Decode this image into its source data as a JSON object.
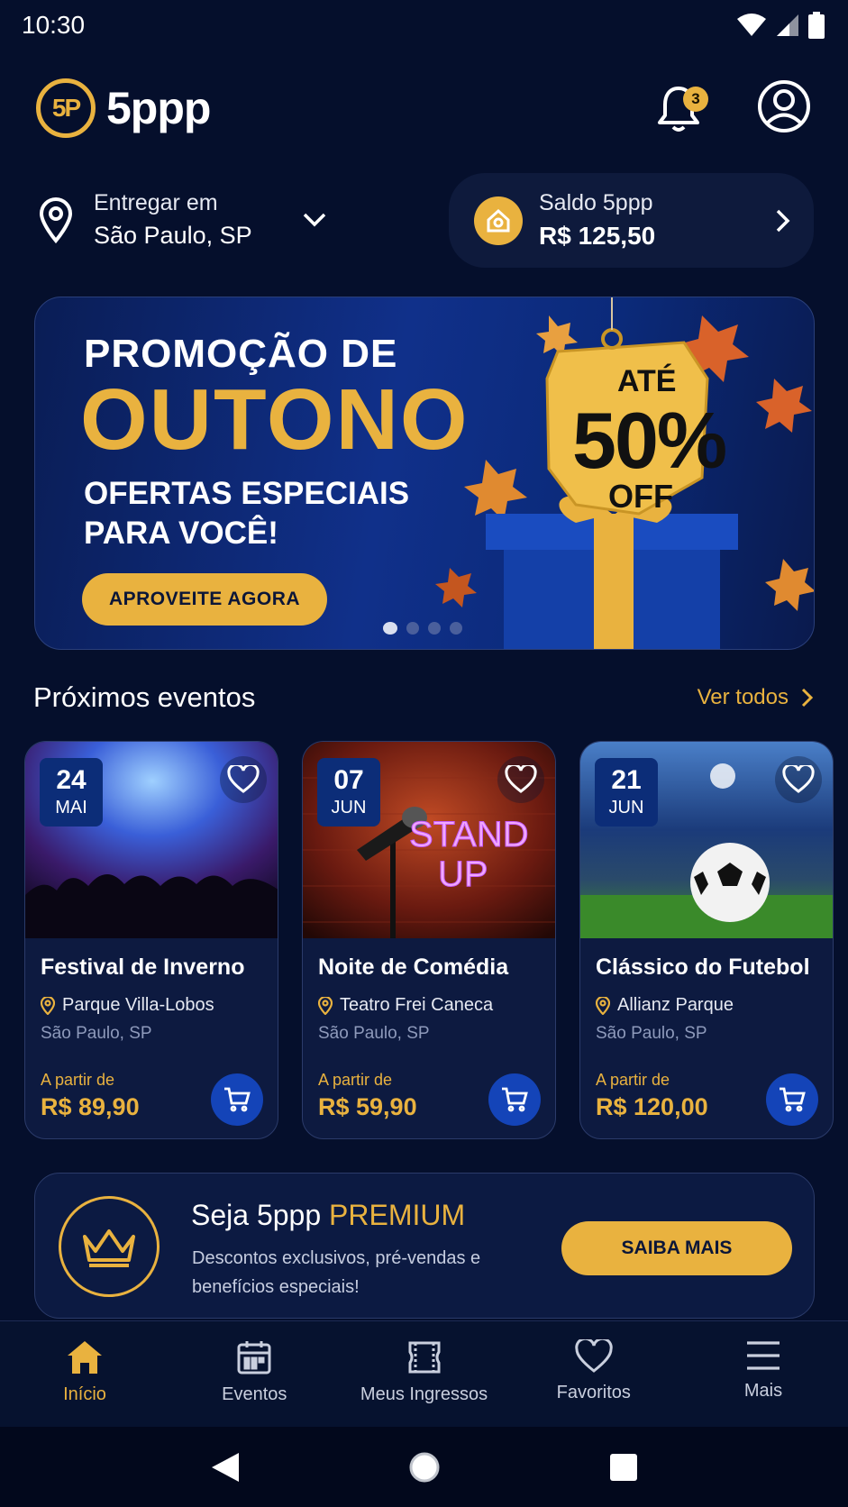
{
  "status_bar": {
    "time": "10:30"
  },
  "header": {
    "brand_name": "5ppp",
    "logo_text": "5P",
    "notifications_count": "3"
  },
  "location": {
    "label": "Entregar em",
    "value": "São Paulo, SP"
  },
  "balance": {
    "label": "Saldo 5ppp",
    "amount": "R$ 125,50"
  },
  "banner": {
    "line1": "PROMOÇÃO DE",
    "line2": "OUTONO",
    "line3": "OFERTAS ESPECIAIS PARA VOCÊ!",
    "cta": "APROVEITE AGORA",
    "tag_line1": "ATÉ",
    "tag_line2": "50%",
    "tag_line3": "OFF",
    "carousel_pages": 4,
    "carousel_active": 1
  },
  "events_section": {
    "title": "Próximos eventos",
    "see_all": "Ver todos"
  },
  "events": [
    {
      "day": "24",
      "month": "MAI",
      "name": "Festival de Inverno",
      "venue": "Parque Villa-Lobos",
      "city": "São Paulo, SP",
      "from_label": "A partir de",
      "price": "R$ 89,90",
      "image": "concert-crowd"
    },
    {
      "day": "07",
      "month": "JUN",
      "name": "Noite de Comédia",
      "venue": "Teatro Frei Caneca",
      "city": "São Paulo, SP",
      "from_label": "A partir de",
      "price": "R$ 59,90",
      "image": "stand-up-microphone",
      "image_text": "STAND UP"
    },
    {
      "day": "21",
      "month": "JUN",
      "name": "Clássico do Futebol",
      "venue": "Allianz Parque",
      "city": "São Paulo, SP",
      "from_label": "A partir de",
      "price": "R$ 120,00",
      "image": "soccer-stadium"
    }
  ],
  "premium": {
    "title_prefix": "Seja 5ppp",
    "title_highlight": "PREMIUM",
    "description": "Descontos exclusivos, pré-vendas e benefícios especiais!",
    "cta": "SAIBA MAIS"
  },
  "tabs": [
    {
      "label": "Início",
      "icon": "home-icon",
      "active": true
    },
    {
      "label": "Eventos",
      "icon": "calendar-icon",
      "active": false
    },
    {
      "label": "Meus Ingressos",
      "icon": "ticket-icon",
      "active": false
    },
    {
      "label": "Favoritos",
      "icon": "heart-icon",
      "active": false
    },
    {
      "label": "Mais",
      "icon": "menu-icon",
      "active": false
    }
  ],
  "colors": {
    "background": "#050f2c",
    "accent_gold": "#e9b23f",
    "primary_blue": "#1444b8",
    "card": "#0d1a40"
  }
}
